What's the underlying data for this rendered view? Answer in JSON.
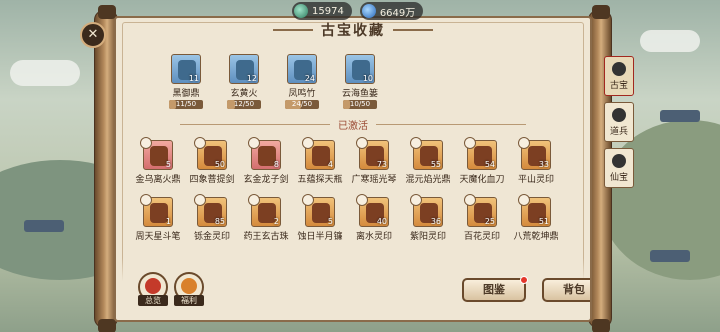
{
  "currency": [
    {
      "icon": "jade-coin-icon",
      "value": "15974"
    },
    {
      "icon": "spirit-gem-icon",
      "value": "6649万"
    }
  ],
  "panel": {
    "title": "古宝收藏",
    "activated_label": "已激活"
  },
  "unowned_items": [
    {
      "name": "黑御鼎",
      "level": "11",
      "progress": "11/50",
      "fraction": 0.22,
      "bg": "blue"
    },
    {
      "name": "玄黄火",
      "level": "12",
      "progress": "12/50",
      "fraction": 0.24,
      "bg": "blue"
    },
    {
      "name": "凤鸣竹",
      "level": "24",
      "progress": "24/50",
      "fraction": 0.48,
      "bg": "blue"
    },
    {
      "name": "云海鱼篓",
      "level": "10",
      "progress": "10/50",
      "fraction": 0.2,
      "bg": "blue"
    }
  ],
  "activated_items": [
    {
      "name": "金乌离火鼎",
      "level": "5",
      "bg": "pink"
    },
    {
      "name": "四象菩提剑",
      "level": "50",
      "bg": "orange"
    },
    {
      "name": "玄金龙子剑",
      "level": "8",
      "bg": "pink"
    },
    {
      "name": "五蕴探天瓶",
      "level": "4",
      "bg": "orange"
    },
    {
      "name": "广寒瑶光琴",
      "level": "73",
      "bg": "orange"
    },
    {
      "name": "混元焰光鼎",
      "level": "55",
      "bg": "orange"
    },
    {
      "name": "天魔化血刀",
      "level": "54",
      "bg": "orange"
    },
    {
      "name": "平山灵印",
      "level": "33",
      "bg": "orange"
    },
    {
      "name": "",
      "level": "",
      "bg": "orange"
    },
    {
      "name": "周天星斗笔",
      "level": "1",
      "bg": "orange"
    },
    {
      "name": "铄金灵印",
      "level": "85",
      "bg": "orange"
    },
    {
      "name": "药王玄古珠",
      "level": "2",
      "bg": "orange"
    },
    {
      "name": "蚀日半月镰",
      "level": "5",
      "bg": "orange"
    },
    {
      "name": "离水灵印",
      "level": "40",
      "bg": "orange"
    },
    {
      "name": "紫阳灵印",
      "level": "36",
      "bg": "orange"
    },
    {
      "name": "百花灵印",
      "level": "25",
      "bg": "orange"
    },
    {
      "name": "八荒乾坤鼎",
      "level": "51",
      "bg": "orange"
    }
  ],
  "buttons": {
    "atlas": "图鉴",
    "bag": "背包"
  },
  "side_tabs": [
    {
      "label": "古宝",
      "icon": "treasure-tab-icon",
      "active": true
    },
    {
      "label": "道兵",
      "icon": "soldier-tab-icon",
      "active": false
    },
    {
      "label": "仙宝",
      "icon": "immortal-treasure-tab-icon",
      "active": false
    }
  ],
  "round_buttons": [
    {
      "label": "总览",
      "icon": "overview-icon"
    },
    {
      "label": "福利",
      "icon": "welfare-icon"
    }
  ]
}
